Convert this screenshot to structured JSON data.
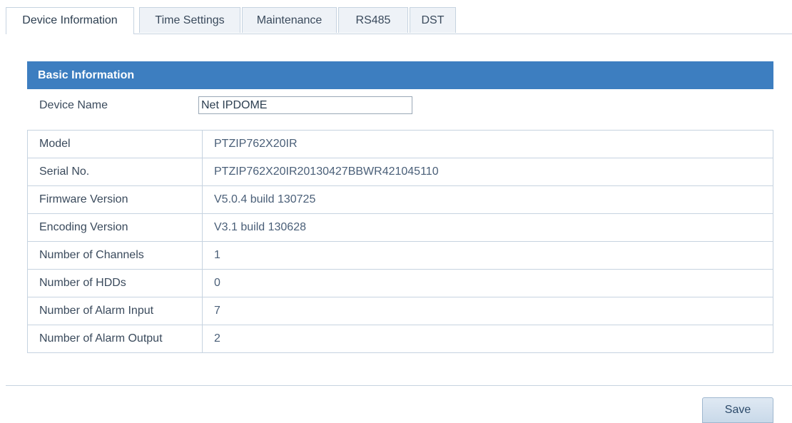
{
  "tabs": [
    {
      "label": "Device Information",
      "active": true
    },
    {
      "label": "Time Settings",
      "active": false
    },
    {
      "label": "Maintenance",
      "active": false
    },
    {
      "label": "RS485",
      "active": false
    },
    {
      "label": "DST",
      "active": false
    }
  ],
  "basic_info": {
    "header": "Basic Information",
    "device_name_label": "Device Name",
    "device_name_value": "Net IPDOME",
    "rows": [
      {
        "label": "Model",
        "value": "PTZIP762X20IR"
      },
      {
        "label": "Serial No.",
        "value": "PTZIP762X20IR20130427BBWR421045110"
      },
      {
        "label": "Firmware Version",
        "value": "V5.0.4 build 130725"
      },
      {
        "label": "Encoding Version",
        "value": "V3.1 build 130628"
      },
      {
        "label": "Number of Channels",
        "value": "1"
      },
      {
        "label": "Number of HDDs",
        "value": "0"
      },
      {
        "label": "Number of Alarm Input",
        "value": "7"
      },
      {
        "label": "Number of Alarm Output",
        "value": "2"
      }
    ]
  },
  "footer": {
    "save_label": "Save"
  },
  "colors": {
    "header_bg": "#3d7ec0",
    "border": "#c6d3e0"
  }
}
